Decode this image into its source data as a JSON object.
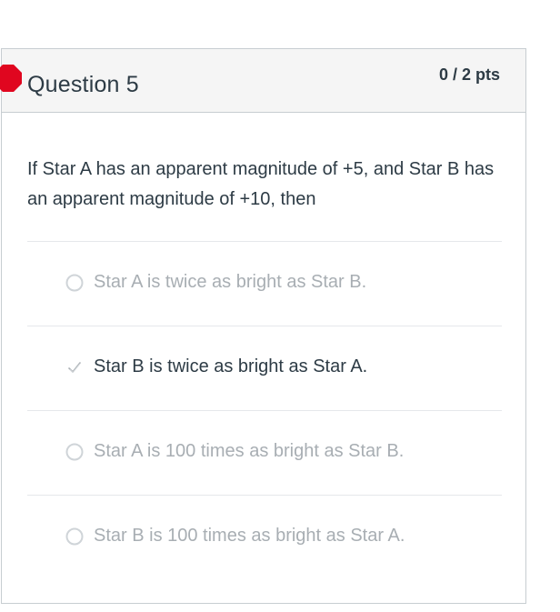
{
  "question": {
    "title": "Question 5",
    "points": "0 / 2 pts",
    "text": "If Star A has an apparent magnitude of +5, and Star B has an apparent magnitude of +10, then"
  },
  "answers": [
    {
      "label": "Star A is twice as bright as Star B.",
      "selected": false
    },
    {
      "label": "Star B is twice as bright as Star A.",
      "selected": true
    },
    {
      "label": "Star A is 100 times as bright as Star B.",
      "selected": false
    },
    {
      "label": "Star B is 100 times as bright as Star A.",
      "selected": false
    }
  ],
  "icons": {
    "incorrect_marker": "incorrect-icon",
    "radio": "radio-icon",
    "selected_answer": "checkmark-icon"
  },
  "colors": {
    "incorrect": "#e0061f",
    "text_primary": "#2d3b45",
    "text_muted": "#a8aeb3"
  }
}
